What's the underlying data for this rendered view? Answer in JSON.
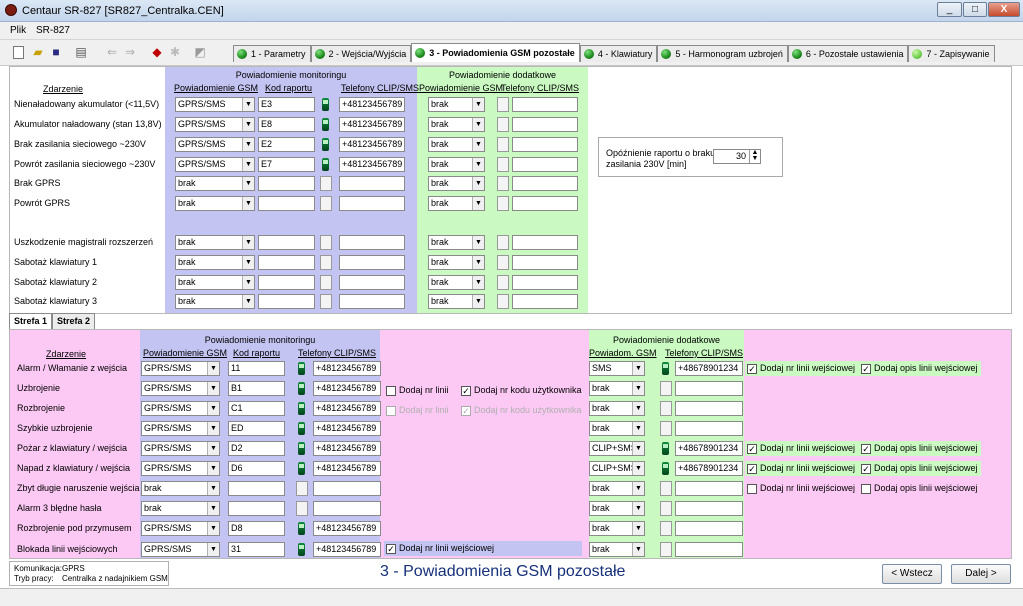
{
  "window": {
    "title": "Centaur SR-827  [SR827_Centralka.CEN]",
    "min": "_",
    "max": "□",
    "close": "X"
  },
  "menu": [
    "Plik",
    "SR-827"
  ],
  "tabs": [
    "1 - Parametry",
    "2 - Wejścia/Wyjścia",
    "3 - Powiadomienia GSM pozostałe",
    "4 - Klawiatury",
    "5 - Harmonogram uzbrojeń",
    "6 - Pozostałe ustawienia",
    "7 - Zapisywanie"
  ],
  "top": {
    "group_monitoring": "Powiadomienie monitoringu",
    "group_additional": "Powiadomienie dodatkowe",
    "col_event": "Zdarzenie",
    "col_gsm": "Powiadomienie GSM",
    "col_code": "Kod raportu",
    "col_phones": "Telefony CLIP/SMS",
    "col_gsm2": "Powiadomienie GSM",
    "col_phones2": "Telefony CLIP/SMS",
    "rows": [
      {
        "event": "Nienaładowany akumulator (<11,5V)",
        "gsm": "GPRS/SMS",
        "code": "E3",
        "phone": "+48123456789",
        "gsm2": "brak",
        "on": true
      },
      {
        "event": "Akumulator naładowany (stan 13,8V)",
        "gsm": "GPRS/SMS",
        "code": "E8",
        "phone": "+48123456789",
        "gsm2": "brak",
        "on": true
      },
      {
        "event": "Brak zasilania sieciowego ~230V",
        "gsm": "GPRS/SMS",
        "code": "E2",
        "phone": "+48123456789",
        "gsm2": "brak",
        "on": true
      },
      {
        "event": "Powrót zasilania sieciowego ~230V",
        "gsm": "GPRS/SMS",
        "code": "E7",
        "phone": "+48123456789",
        "gsm2": "brak",
        "on": true
      },
      {
        "event": "Brak GPRS",
        "gsm": "brak",
        "code": "",
        "phone": "",
        "gsm2": "brak",
        "on": false
      },
      {
        "event": "Powrót GPRS",
        "gsm": "brak",
        "code": "",
        "phone": "",
        "gsm2": "brak",
        "on": false
      },
      {
        "event": "Uszkodzenie magistrali rozszerzeń",
        "gsm": "brak",
        "code": "",
        "phone": "",
        "gsm2": "brak",
        "on": false
      },
      {
        "event": "Sabotaż klawiatury 1",
        "gsm": "brak",
        "code": "",
        "phone": "",
        "gsm2": "brak",
        "on": false
      },
      {
        "event": "Sabotaż klawiatury 2",
        "gsm": "brak",
        "code": "",
        "phone": "",
        "gsm2": "brak",
        "on": false
      },
      {
        "event": "Sabotaż klawiatury 3",
        "gsm": "brak",
        "code": "",
        "phone": "",
        "gsm2": "brak",
        "on": false
      }
    ],
    "delay_label": "Opóźnienie raportu o braku zasilania 230V [min]",
    "delay_value": "30"
  },
  "zone_tabs": [
    "Strefa 1",
    "Strefa 2"
  ],
  "zone": {
    "group_monitoring": "Powiadomienie monitoringu",
    "group_additional": "Powiadomienie dodatkowe",
    "col_event": "Zdarzenie",
    "col_gsm": "Powiadomienie GSM",
    "col_code": "Kod raportu",
    "col_phones": "Telefony CLIP/SMS",
    "col_gsm2": "Powiadom. GSM",
    "col_phones2": "Telefony CLIP/SMS",
    "rows": [
      {
        "event": "Alarm / Włamanie z wejścia",
        "gsm": "GPRS/SMS",
        "code": "11",
        "phone": "+48123456789",
        "gsm2": "SMS",
        "phone2": "+48678901234",
        "on": true,
        "on2": true
      },
      {
        "event": "Uzbrojenie",
        "gsm": "GPRS/SMS",
        "code": "B1",
        "phone": "+48123456789",
        "gsm2": "brak",
        "phone2": "",
        "on": true,
        "on2": false
      },
      {
        "event": "Rozbrojenie",
        "gsm": "GPRS/SMS",
        "code": "C1",
        "phone": "+48123456789",
        "gsm2": "brak",
        "phone2": "",
        "on": true,
        "on2": false
      },
      {
        "event": "Szybkie uzbrojenie",
        "gsm": "GPRS/SMS",
        "code": "ED",
        "phone": "+48123456789",
        "gsm2": "brak",
        "phone2": "",
        "on": true,
        "on2": false
      },
      {
        "event": "Pożar z klawiatury / wejścia",
        "gsm": "GPRS/SMS",
        "code": "D2",
        "phone": "+48123456789",
        "gsm2": "CLIP+SMS",
        "phone2": "+48678901234",
        "on": true,
        "on2": true
      },
      {
        "event": "Napad z klawiatury / wejścia",
        "gsm": "GPRS/SMS",
        "code": "D6",
        "phone": "+48123456789",
        "gsm2": "CLIP+SMS",
        "phone2": "+48678901234",
        "on": true,
        "on2": true
      },
      {
        "event": "Zbyt długie naruszenie wejścia",
        "gsm": "brak",
        "code": "",
        "phone": "",
        "gsm2": "brak",
        "phone2": "",
        "on": false,
        "on2": false
      },
      {
        "event": "Alarm 3 błędne hasła",
        "gsm": "brak",
        "code": "",
        "phone": "",
        "gsm2": "brak",
        "phone2": "",
        "on": false,
        "on2": false
      },
      {
        "event": "Rozbrojenie pod przymusem",
        "gsm": "GPRS/SMS",
        "code": "D8",
        "phone": "+48123456789",
        "gsm2": "brak",
        "phone2": "",
        "on": true,
        "on2": false
      },
      {
        "event": "Blokada linii wejściowych",
        "gsm": "GPRS/SMS",
        "code": "31",
        "phone": "+48123456789",
        "gsm2": "brak",
        "phone2": "",
        "on": true,
        "on2": false
      }
    ],
    "opt_line_nr": "Dodaj nr linii",
    "opt_user_code": "Dodaj nr kodu użytkownika",
    "opt_line_nr2": "Dodaj nr linii",
    "opt_user_code2": "Dodaj nr kodu użytkownika",
    "opt_input_nr": "Dodaj nr linii wejściowej",
    "opt_input_desc": "Dodaj opis linii wejściowej"
  },
  "status": {
    "comm_label": "Komunikacja:",
    "comm_value": "GPRS",
    "mode_label": "Tryb pracy:",
    "mode_value": "Centralka z nadajnikiem GSM"
  },
  "footer_title": "3 - Powiadomienia GSM pozostałe",
  "btn_back": "< Wstecz",
  "btn_next": "Dalej >"
}
